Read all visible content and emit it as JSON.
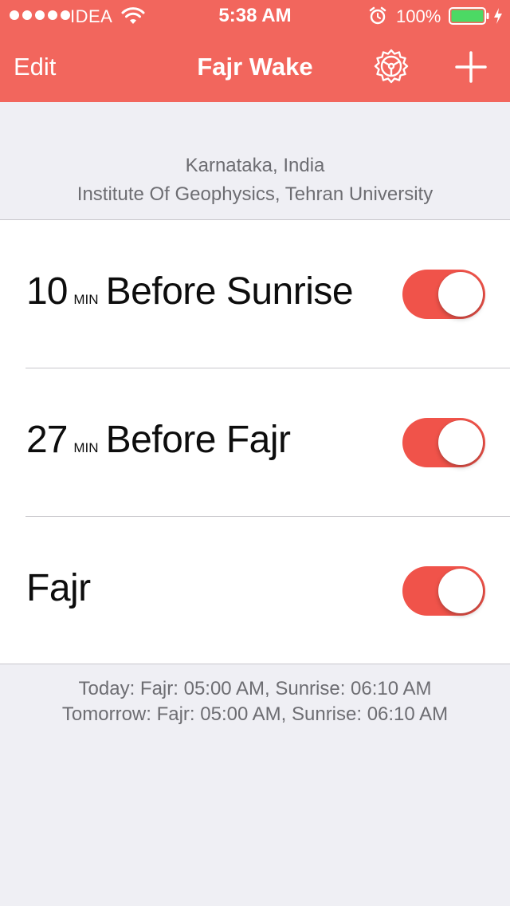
{
  "status_bar": {
    "carrier": "IDEA",
    "time": "5:38 AM",
    "battery_percent": "100%",
    "signal_bars": 5,
    "battery_level": 1.0,
    "battery_color": "#4cd964"
  },
  "nav": {
    "edit_label": "Edit",
    "title": "Fajr Wake",
    "settings_icon": "gear-icon",
    "add_icon": "plus-icon",
    "accent_color": "#f2665d"
  },
  "location": {
    "region": "Karnataka, India",
    "method": "Institute Of Geophysics, Tehran University"
  },
  "alarms": [
    {
      "minutes": "10",
      "unit": "MIN",
      "label": "Before Sunrise",
      "enabled": true
    },
    {
      "minutes": "27",
      "unit": "MIN",
      "label": "Before Fajr",
      "enabled": true
    },
    {
      "minutes": "",
      "unit": "",
      "label": "Fajr",
      "enabled": true
    }
  ],
  "footer": {
    "today": "Today: Fajr: 05:00 AM, Sunrise: 06:10 AM",
    "tomorrow": "Tomorrow: Fajr: 05:00 AM, Sunrise: 06:10 AM"
  }
}
